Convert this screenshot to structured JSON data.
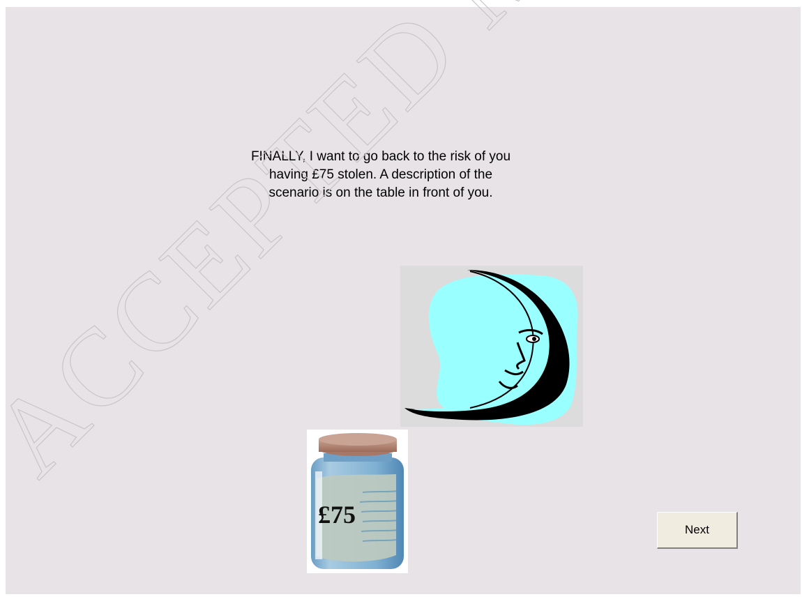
{
  "instruction": {
    "text": "FINALLY, I want to go back to the risk of you\nhaving £75 stolen. A description of the\nscenario is on the table in front of you."
  },
  "images": {
    "moon": {
      "icon": "crescent-moon-face-icon",
      "sky_color": "#99ffff"
    },
    "jar": {
      "icon": "money-jar-icon",
      "label": "£75"
    }
  },
  "watermark": {
    "text": "ACCEPTED MA"
  },
  "navigation": {
    "next_label": "Next"
  }
}
